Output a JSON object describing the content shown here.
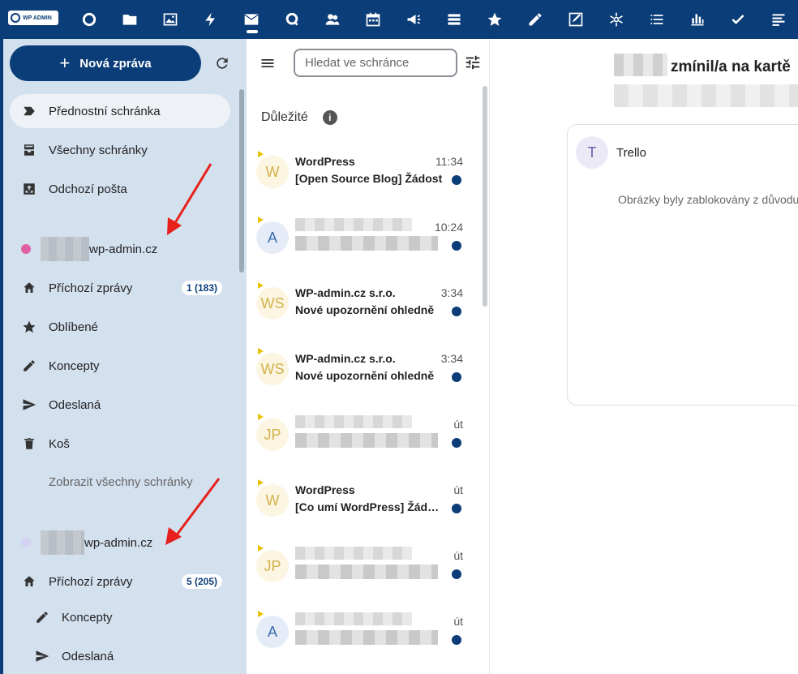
{
  "topbar": {
    "logo_text": "WP ADMIN",
    "apps": [
      "circle-icon",
      "folder-icon",
      "image-icon",
      "bolt-icon",
      "mail-icon",
      "search-icon",
      "contacts-icon",
      "calendar-icon",
      "megaphone-icon",
      "stack-icon",
      "star-icon",
      "pencil-icon",
      "notes-icon",
      "network-icon",
      "list-icon",
      "chart-icon",
      "check-icon",
      "menu-lines-icon"
    ],
    "active_app": "mail-icon",
    "color": "#0b3d78"
  },
  "sidebar": {
    "compose_label": "Nová zpráva",
    "items": [
      {
        "label": "Přednostní schránka",
        "icon": "priority-icon",
        "selected": true
      },
      {
        "label": "Všechny schránky",
        "icon": "inbox-stack-icon"
      },
      {
        "label": "Odchozí pošta",
        "icon": "outbox-icon"
      }
    ],
    "account1": {
      "name": "wp-admin.cz",
      "color": "#e05fa4",
      "items": [
        {
          "label": "Příchozí zprávy",
          "icon": "home-icon",
          "badge": "1 (183)"
        },
        {
          "label": "Oblíbené",
          "icon": "star-icon"
        },
        {
          "label": "Koncepty",
          "icon": "pencil-icon"
        },
        {
          "label": "Odeslaná",
          "icon": "send-icon"
        },
        {
          "label": "Koš",
          "icon": "trash-icon"
        }
      ]
    },
    "show_all_label": "Zobrazit všechny schránky",
    "account2": {
      "name": "wp-admin.cz",
      "color": "#d4d2f5",
      "items": [
        {
          "label": "Příchozí zprávy",
          "icon": "home-icon",
          "badge": "5 (205)"
        },
        {
          "label": "Koncepty",
          "icon": "pencil-icon"
        },
        {
          "label": "Odeslaná",
          "icon": "send-icon"
        }
      ]
    }
  },
  "list": {
    "search_placeholder": "Hledat ve schránce",
    "section_title": "Důležité",
    "info_label": "i",
    "messages": [
      {
        "initials": "W",
        "color": "yellow",
        "sender": "WordPress",
        "time": "11:34",
        "subject": "[Open Source Blog] Žádost"
      },
      {
        "initials": "A",
        "color": "blue",
        "sender": "",
        "time": "10:24",
        "subject": "",
        "blurred": true
      },
      {
        "initials": "WS",
        "color": "yellow",
        "sender": "WP-admin.cz s.r.o.",
        "time": "3:34",
        "subject": "Nové upozornění ohledně"
      },
      {
        "initials": "WS",
        "color": "yellow",
        "sender": "WP-admin.cz s.r.o.",
        "time": "3:34",
        "subject": "Nové upozornění ohledně"
      },
      {
        "initials": "JP",
        "color": "yellow",
        "sender": "",
        "time": "út",
        "subject": "",
        "blurred": true
      },
      {
        "initials": "W",
        "color": "yellow",
        "sender": "WordPress",
        "time": "út",
        "subject": "[Co umí WordPress] Žádost"
      },
      {
        "initials": "JP",
        "color": "yellow",
        "sender": "",
        "time": "út",
        "subject": "",
        "blurred": true
      },
      {
        "initials": "A",
        "color": "blue",
        "sender": "",
        "time": "út",
        "subject": "",
        "blurred": true
      }
    ]
  },
  "reading": {
    "title": "zmínil/a na kartě",
    "from_initial": "T",
    "from_name": "Trello",
    "blocked_text": "Obrázky byly zablokovány z důvodu"
  }
}
